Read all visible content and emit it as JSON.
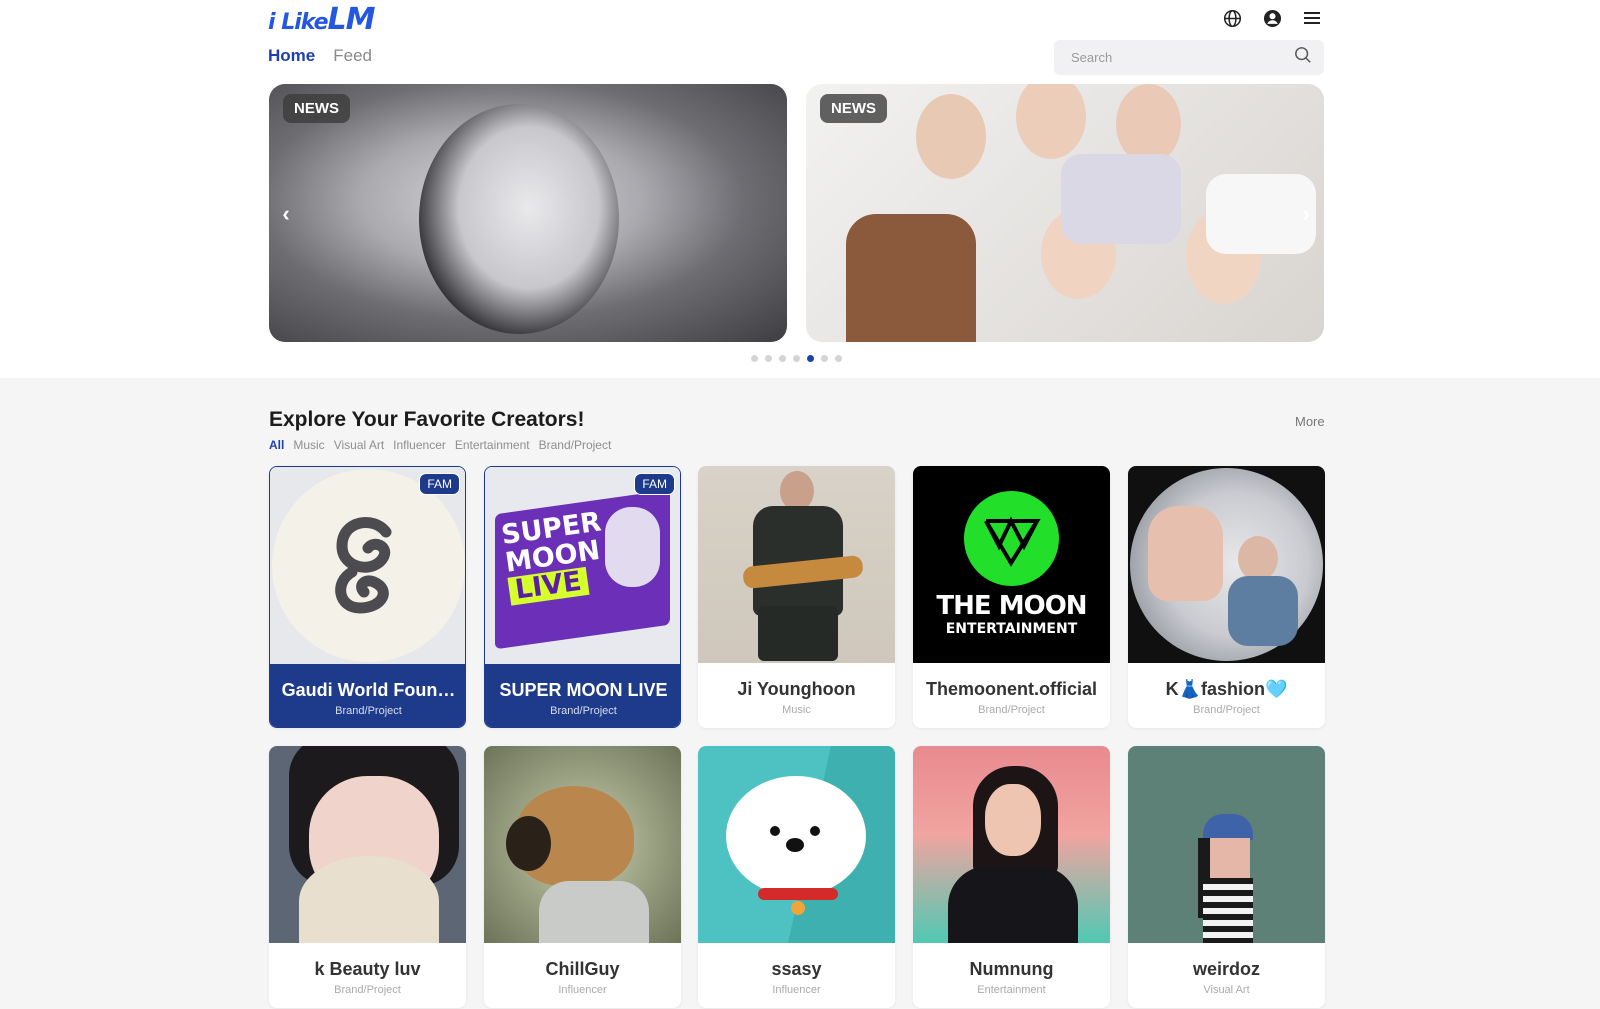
{
  "header": {
    "logo_small": "i Like",
    "logo_big": "LM",
    "icons": [
      "globe-icon",
      "account-icon",
      "menu-icon"
    ]
  },
  "nav": {
    "tabs": [
      "Home",
      "Feed"
    ]
  },
  "search": {
    "placeholder": "Search"
  },
  "banner": {
    "slides": [
      {
        "tag": "NEWS"
      },
      {
        "tag": "NEWS"
      }
    ],
    "dot_count": 7,
    "active_dot": 5
  },
  "section": {
    "title": "Explore Your Favorite Creators!",
    "more_label": "More",
    "filters": [
      "All",
      "Music",
      "Visual Art",
      "Influencer",
      "Entertainment",
      "Brand/Project"
    ]
  },
  "creators": [
    {
      "name": "Gaudi World Foun…",
      "category": "Brand/Project",
      "badge": "FAM"
    },
    {
      "name": "SUPER MOON LIVE",
      "category": "Brand/Project",
      "badge": "FAM"
    },
    {
      "name": "Ji Younghoon",
      "category": "Music",
      "badge": ""
    },
    {
      "name": "Themoonent.official",
      "category": "Brand/Project",
      "badge": ""
    },
    {
      "name": "K👗fashion🩵",
      "category": "Brand/Project",
      "badge": ""
    },
    {
      "name": "k Beauty luv",
      "category": "Brand/Project",
      "badge": ""
    },
    {
      "name": "ChillGuy",
      "category": "Influencer",
      "badge": ""
    },
    {
      "name": "ssasy",
      "category": "Influencer",
      "badge": ""
    },
    {
      "name": "Numnung",
      "category": "Entertainment",
      "badge": ""
    },
    {
      "name": "weirdoz",
      "category": "Visual Art",
      "badge": ""
    }
  ],
  "thumb_text": {
    "supermoon": [
      "SUPER",
      "MOON",
      "LIVE"
    ],
    "themoon": [
      "THE MOON",
      "ENTERTAINMENT"
    ]
  },
  "colors": {
    "accent": "#1f3fae",
    "fam": "#1e3a8a",
    "logo": "#2457e0"
  }
}
